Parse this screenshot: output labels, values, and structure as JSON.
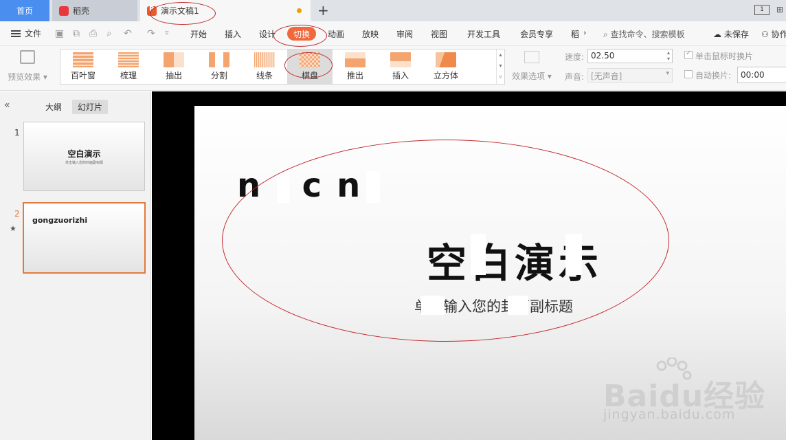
{
  "tabs": {
    "home": "首页",
    "daoke": "稻壳",
    "document": "演示文稿1"
  },
  "window": {
    "layout_label": "1"
  },
  "menu": {
    "file": "文件",
    "items": [
      "开始",
      "插入",
      "设计",
      "动画",
      "放映",
      "审阅",
      "视图",
      "开发工具",
      "会员专享",
      "稻"
    ],
    "active": "切换",
    "search": "查找命令、搜索模板",
    "unsaved": "未保存",
    "collab": "协作"
  },
  "ribbon": {
    "preview": "预览效果",
    "effects": [
      "百叶窗",
      "梳理",
      "抽出",
      "分割",
      "线条",
      "棋盘",
      "推出",
      "插入",
      "立方体"
    ],
    "selected_effect": "棋盘",
    "effect_options": "效果选项",
    "speed_label": "速度:",
    "speed_value": "02.50",
    "sound_label": "声音:",
    "sound_value": "[无声音]",
    "click_switch": "单击鼠标时换片",
    "auto_switch": "自动换片:",
    "auto_time": "00:00"
  },
  "leftpanel": {
    "tab_outline": "大纲",
    "tab_slides": "幻灯片",
    "slides": [
      {
        "num": "1",
        "title": "空白演示",
        "subtitle": "单击输入您的封面副标题"
      },
      {
        "num": "2",
        "title": "gongzuorizhi"
      }
    ]
  },
  "slide": {
    "garbled": "nicn",
    "title": "空白演示",
    "subtitle": "单击输入您的封面副标题"
  },
  "watermark": {
    "main": "Baidu经验",
    "sub": "jingyan.baidu.com"
  },
  "colors": {
    "accent": "#f0683c",
    "home_tab": "#4a8ef0",
    "annotation": "#c0282d",
    "selected_slide_border": "#e07a3c"
  }
}
